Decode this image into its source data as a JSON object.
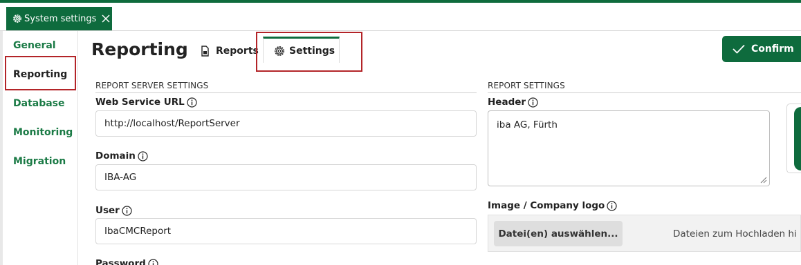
{
  "window": {
    "tab_title": "System settings",
    "icons": {
      "tab": "gear-icon",
      "close": "close-icon"
    }
  },
  "sidebar": {
    "items": [
      {
        "label": "General"
      },
      {
        "label": "Reporting",
        "selected": true
      },
      {
        "label": "Database"
      },
      {
        "label": "Monitoring"
      },
      {
        "label": "Migration"
      }
    ]
  },
  "header": {
    "title": "Reporting",
    "tabs": [
      {
        "label": "Reports",
        "icon": "report-document-icon"
      },
      {
        "label": "Settings",
        "icon": "gear-icon",
        "active": true
      }
    ],
    "confirm_label": "Confirm"
  },
  "report_server": {
    "section_title": "REPORT SERVER SETTINGS",
    "fields": [
      {
        "label": "Web Service URL",
        "value": "http://localhost/ReportServer"
      },
      {
        "label": "Domain",
        "value": "IBA-AG"
      },
      {
        "label": "User",
        "value": "IbaCMCReport"
      },
      {
        "label": "Password"
      }
    ]
  },
  "report_settings": {
    "section_title": "REPORT SETTINGS",
    "header_label": "Header",
    "header_value": "iba AG, Fürth",
    "logo_label": "Image / Company logo",
    "upload_button": "Datei(en) auswählen...",
    "upload_hint": "Dateien zum Hochladen hi"
  },
  "colors": {
    "accent": "#0e6b3d",
    "sidebar_text": "#1a7a45",
    "highlight": "#b32428"
  }
}
